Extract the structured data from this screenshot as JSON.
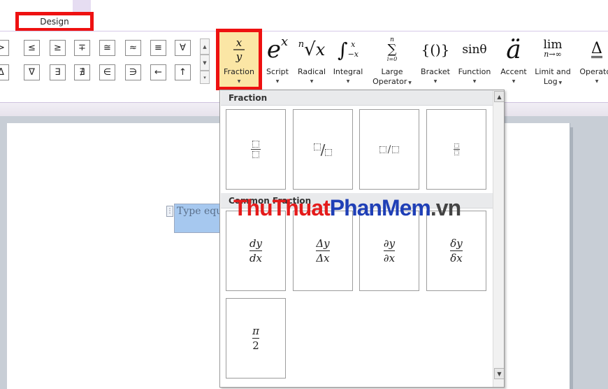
{
  "ribbon": {
    "tab_label": "Design",
    "symbols_row1": [
      ">",
      "≤",
      "≥",
      "∓",
      "≅",
      "≈",
      "≡",
      "∀"
    ],
    "symbols_row2": [
      "Δ",
      "∇",
      "∃",
      "∄",
      "∈",
      "∋",
      "←",
      "↑"
    ],
    "buttons": [
      {
        "label": "Fraction",
        "icon": "fraction-icon"
      },
      {
        "label": "Script",
        "icon": "script-icon"
      },
      {
        "label": "Radical",
        "icon": "radical-icon"
      },
      {
        "label": "Integral",
        "icon": "integral-icon"
      },
      {
        "label": "Large",
        "label2": "Operator",
        "icon": "large-operator-icon"
      },
      {
        "label": "Bracket",
        "icon": "bracket-icon"
      },
      {
        "label": "Function",
        "icon": "function-icon"
      },
      {
        "label": "Accent",
        "icon": "accent-icon"
      },
      {
        "label": "Limit and",
        "label2": "Log",
        "icon": "limit-log-icon"
      },
      {
        "label": "Operator",
        "icon": "operator-icon"
      }
    ]
  },
  "document": {
    "equation_placeholder": "Type equation here."
  },
  "gallery": {
    "section1_title": "Fraction",
    "section2_title": "Common Fraction",
    "fraction_tiles": [
      "stacked-fraction",
      "skewed-fraction",
      "linear-fraction",
      "small-fraction"
    ],
    "common_fractions": [
      {
        "num": "dy",
        "den": "dx"
      },
      {
        "num": "Δy",
        "den": "Δx"
      },
      {
        "num": "∂y",
        "den": "∂x"
      },
      {
        "num": "δy",
        "den": "δx"
      },
      {
        "num": "π",
        "den": "2"
      }
    ]
  },
  "watermark": {
    "part1": "ThuThuat",
    "part2": "PhanMem",
    "part3": ".vn"
  },
  "colors": {
    "highlight_red": "#ee1111",
    "fraction_button_bg": "#fbe6a5",
    "equation_selection": "#a6c8ef"
  }
}
